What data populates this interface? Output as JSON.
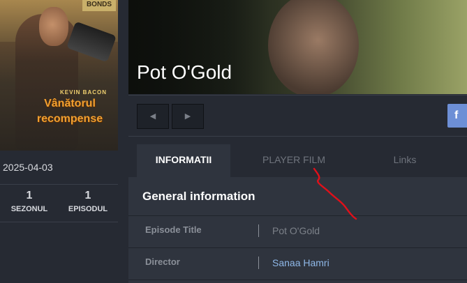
{
  "poster": {
    "sign_text": "BONDS",
    "actor": "KEVIN BACON",
    "title_line1": "Vânătorul",
    "title_line2": "recompense"
  },
  "sidebar": {
    "date": "2025-04-03",
    "season_count": "1",
    "season_label": "SEZONUL",
    "episode_count": "1",
    "episode_label": "EPISODUL"
  },
  "hero": {
    "title": "Pot O'Gold"
  },
  "toolbar": {
    "prev_icon": "◀",
    "next_icon": "▶",
    "facebook_label": "f"
  },
  "tabs": [
    {
      "label": "INFORMATII",
      "active": true
    },
    {
      "label": "PLAYER FILM",
      "active": false
    },
    {
      "label": "Links",
      "active": false
    }
  ],
  "info": {
    "heading": "General information",
    "rows": [
      {
        "key": "Episode Title",
        "value": "Pot O'Gold"
      },
      {
        "key": "Director",
        "value": "Sanaa Hamri"
      }
    ]
  },
  "colors": {
    "background": "#262a33",
    "panel": "#2f343e",
    "facebook": "#6d8fd6",
    "link": "#8fb8e8",
    "annotation": "#e0101a"
  }
}
